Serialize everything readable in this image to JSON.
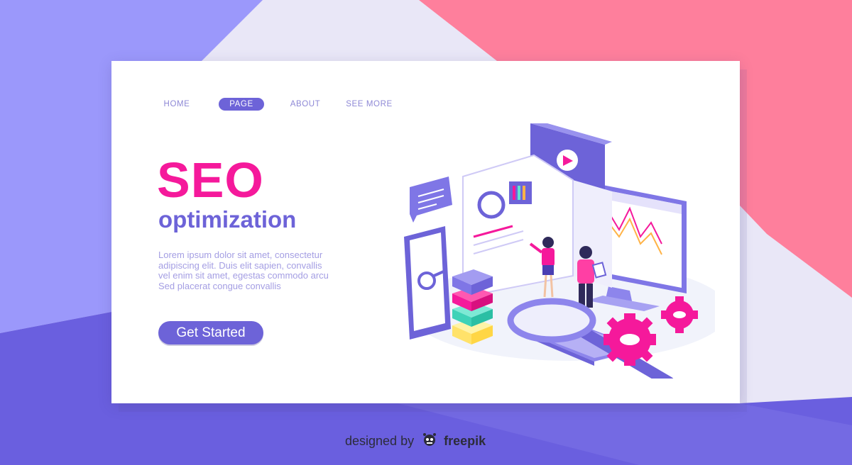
{
  "nav": {
    "items": [
      {
        "label": "HOME",
        "active": false
      },
      {
        "label": "PAGE",
        "active": true
      },
      {
        "label": "ABOUT",
        "active": false
      },
      {
        "label": "SEE MORE",
        "active": false
      }
    ]
  },
  "hero": {
    "title": "SEO",
    "subtitle": "optimization",
    "body_lines": [
      "Lorem ipsum dolor sit amet, consectetur",
      "adipiscing elit. Duis  elit  sapien,  convallis",
      "vel  enim  sit amet,  egestas  commodo arcu",
      "Sed placerat congue convallis"
    ],
    "cta_label": "Get Started"
  },
  "credit": {
    "prefix": "designed by",
    "brand": "freepik"
  },
  "colors": {
    "primary": "#6d63d8",
    "accent": "#f5199b",
    "coral": "#fe7f9c",
    "periwinkle": "#9b98fb",
    "background": "#e9e7f7"
  },
  "icons": [
    "play-icon",
    "refresh-icon",
    "chat-icon",
    "magnifier-icon",
    "gear-icon",
    "keyboard-icon",
    "freepik-logo-icon"
  ]
}
